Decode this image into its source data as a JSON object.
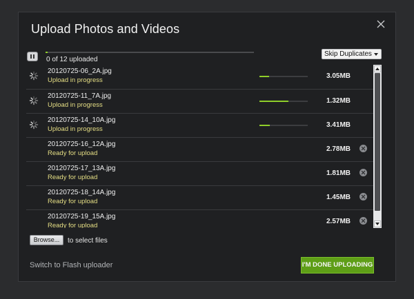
{
  "dialog": {
    "title": "Upload Photos and Videos",
    "close_icon": "close-icon"
  },
  "toolbar": {
    "pause_icon": "pause-icon",
    "overall_progress_fraction": 0.01,
    "overall_status": "0 of 12 uploaded",
    "skip_select": {
      "selected": "Skip Duplicates",
      "icon": "caret-down-icon"
    }
  },
  "files": [
    {
      "name": "20120725-06_2A.jpg",
      "status": "Upload in progress",
      "size": "3.05MB",
      "uploading": true,
      "progress": 0.2
    },
    {
      "name": "20120725-11_7A.jpg",
      "status": "Upload in progress",
      "size": "1.32MB",
      "uploading": true,
      "progress": 0.6
    },
    {
      "name": "20120725-14_10A.jpg",
      "status": "Upload in progress",
      "size": "3.41MB",
      "uploading": true,
      "progress": 0.22
    },
    {
      "name": "20120725-16_12A.jpg",
      "status": "Ready for upload",
      "size": "2.78MB",
      "uploading": false
    },
    {
      "name": "20120725-17_13A.jpg",
      "status": "Ready for upload",
      "size": "1.81MB",
      "uploading": false
    },
    {
      "name": "20120725-18_14A.jpg",
      "status": "Ready for upload",
      "size": "1.45MB",
      "uploading": false
    },
    {
      "name": "20120725-19_15A.jpg",
      "status": "Ready for upload",
      "size": "2.57MB",
      "uploading": false
    }
  ],
  "footer": {
    "browse_label": "Browse...",
    "browse_hint": "to select files",
    "flash_link": "Switch to Flash uploader",
    "done_label": "I'M DONE UPLOADING"
  },
  "colors": {
    "accent_green": "#5e9e17",
    "progress_green": "#8fcf2a",
    "status_yellow": "#e6df85",
    "background": "#1f2022"
  }
}
